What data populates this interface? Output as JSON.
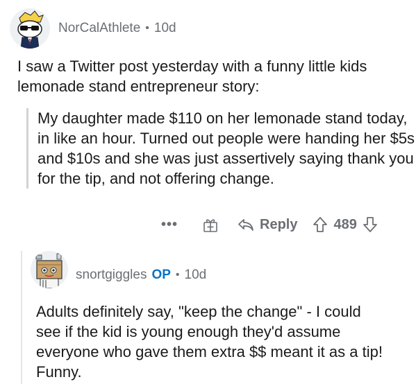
{
  "comment1": {
    "username": "NorCalAthlete",
    "separator": "•",
    "age": "10d",
    "body": "I saw a Twitter post yesterday with a funny little kids lemonade stand entrepreneur story:",
    "quote": "My daughter made $110 on her lemonade stand today, in like an hour. Turned out people were handing her $5s and $10s and she was just assertively saying thank you for the tip, and not offering change."
  },
  "actions": {
    "more": "•••",
    "reply_label": "Reply",
    "score": "489"
  },
  "comment2": {
    "username": "snortgiggles",
    "op_badge": "OP",
    "separator": "•",
    "age": "10d",
    "body": "Adults definitely say, \"keep the change\" - I could see if the kid is young enough they'd assume everyone who gave them extra $$ meant it as a tip! Funny."
  },
  "colors": {
    "text": "#1a1a1b",
    "meta": "#6b6f73",
    "op": "#0a72c7",
    "quote_bar": "#d0d3d6"
  }
}
